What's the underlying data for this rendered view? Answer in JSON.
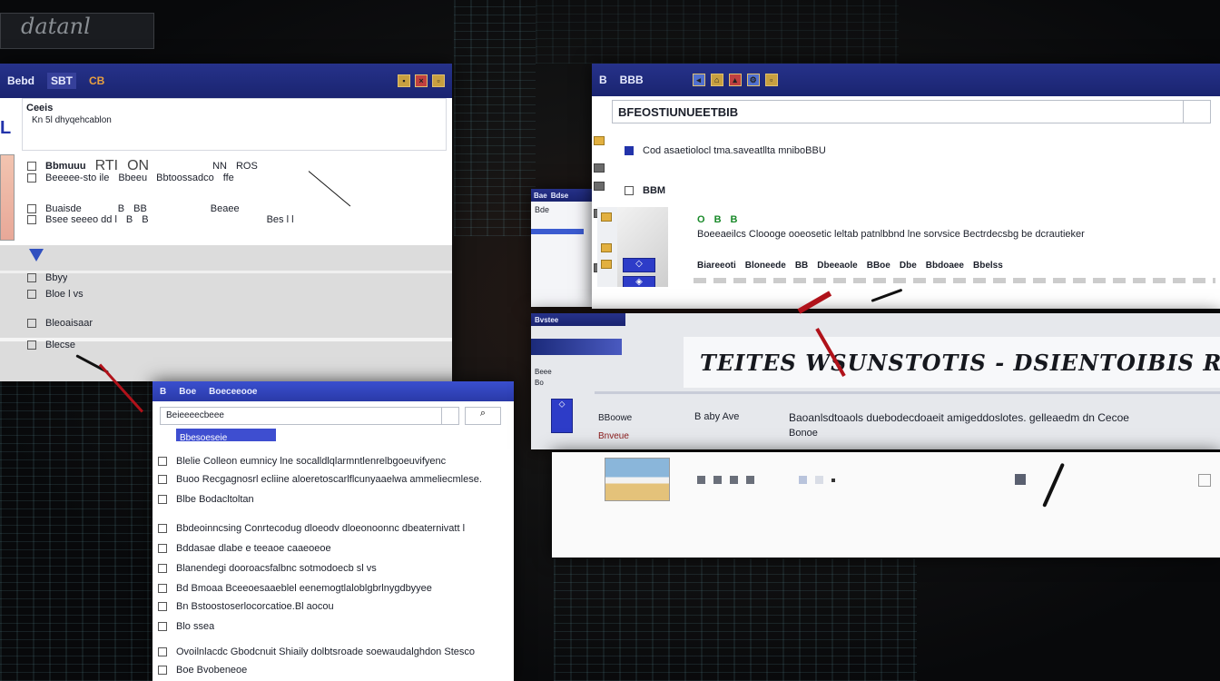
{
  "background": {
    "logo_text": "datanl"
  },
  "window_left": {
    "title_tabs": [
      "Bebd",
      "SBT",
      "CB"
    ],
    "toolbar_icons": [
      "folder-icon",
      "close-icon",
      "window-icon"
    ],
    "header_text": "Ceeis",
    "subheader": "Kn 5l dhyqehcablon",
    "row1": {
      "a": "Bbmuuu",
      "b": "RTI",
      "c": "ON",
      "d": "NN",
      "e": "ROS"
    },
    "row2": {
      "a": "Beeeee-sto ile",
      "b": "Bbeeu",
      "c": "Bbtoossadco",
      "d": "ffe"
    },
    "row3": {
      "a": "Buaisde",
      "b": "B",
      "c": "BB",
      "d": "Beaee"
    },
    "row4": {
      "a": "Bsee seeeo dd l",
      "b": "B",
      "c": "B",
      "d": "Bes l l"
    },
    "list": [
      "Bbyy",
      "Bloe l vs",
      "Bleoaisaar",
      "Blecse"
    ]
  },
  "window_small": {
    "title_tabs": [
      "Bae",
      "Bdse"
    ],
    "tiny_text": "Bde"
  },
  "window_bottom": {
    "title_tabs": [
      "B",
      "Boe",
      "Boeceeooe"
    ],
    "search_value": "Beieeeecbeee",
    "selected_row": "Bbesoeseie",
    "items": [
      "Blelie Colleon eumnicy lne socalldlqlarmntlenrelbgoeuvifyenc",
      "Buoo Recgagnosrl ecliine aloeretoscarlflcunyaaelwa ammeliecmlese.",
      "Blbe Bodacltoltan",
      "Bbdeoinncsing Conrtecodug dloeodv dloeonoonnc dbeaternivatt l",
      "Bddasae dlabe e teeaoe caaeoeoe",
      "Blanendegi dooroacsfalbnc sotmodoecb sl vs",
      "Bd Bmoaa Bceeoesaaeblel eenemogtlaloblgbrlnygdbyyee",
      "Bn Bstoostoserlocorcatioe.Bl aocou",
      "Blo ssea",
      "Ovoilnlacdc Gbodcnuit Shiaily dolbtsroade soewaudalghdon Stesco",
      "Boe Bvobeneoe"
    ]
  },
  "window_right": {
    "title_tabs": [
      "B",
      "BBB"
    ],
    "address_value": "BFEOSTIUNUEETBIB",
    "option_text": "Cod asaetiolocl tma.saveatllta mniboBBU",
    "label_b": "BBM",
    "green_labels": [
      "O",
      "B",
      "B"
    ],
    "left_subtexts": [
      "Bvstee",
      "Beee",
      "Bo"
    ],
    "row_text": "Boeeaeilcs Cloooge     ooeosetic    leltab patnlbbnd lne sorvsice    Bectrdecsbg be dcrautieker",
    "col_labels": [
      "Biareeoti",
      "Bloneede",
      "BB",
      "Dbeeaole",
      "BBoe",
      "Dbe",
      "Bbdoaee",
      "Bbelss"
    ],
    "heading": "TEITES WSUNSTOTIS - DSIENTOIBIS RSGINS",
    "left_col": [
      "BBoowe",
      "Bnveue"
    ],
    "desc_label": "B aby Ave",
    "desc_text": "Baoanlsdtoaols duebodecdoaeit amigeddoslotes. gelleaedm dn Cecoe",
    "desc_sub": "Bonoe"
  }
}
